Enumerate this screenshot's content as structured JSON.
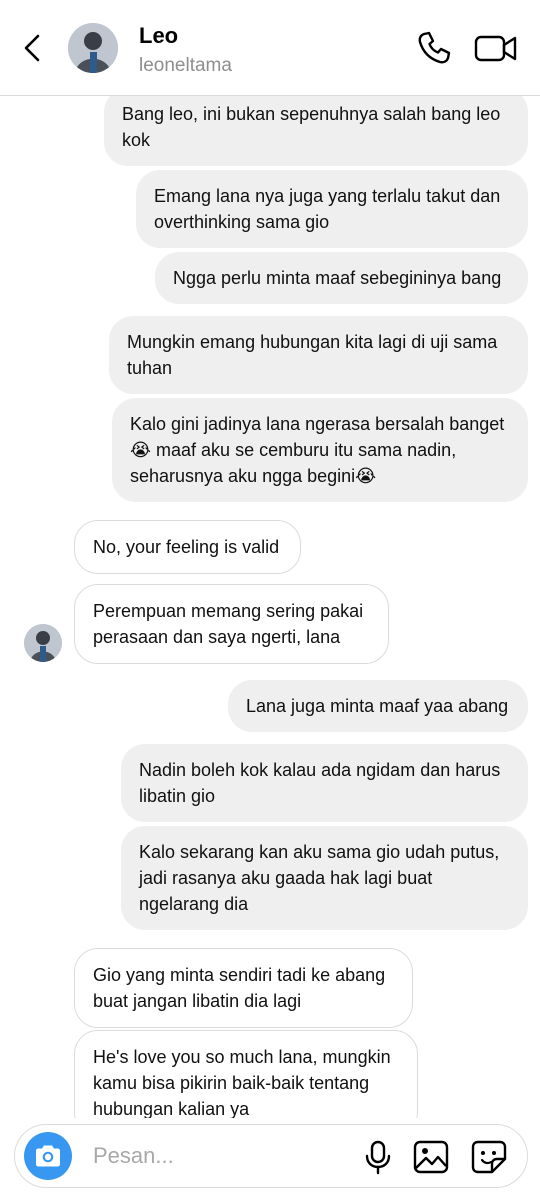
{
  "header": {
    "name": "Leo",
    "username": "leoneltama"
  },
  "messages": [
    {
      "from": "me",
      "text": "Bang leo, ini bukan sepenuhnya salah bang leo\nkok"
    },
    {
      "from": "me",
      "text": "Emang lana nya juga yang terlalu takut dan\noverthinking sama gio"
    },
    {
      "from": "me",
      "text": "Ngga perlu minta maaf sebegininya bang"
    },
    {
      "from": "me",
      "text": "Mungkin emang hubungan kita lagi di uji sama\ntuhan"
    },
    {
      "from": "me",
      "text": "Kalo gini jadinya lana ngerasa bersalah banget\n😭 maaf aku se cemburu itu sama nadin,\nseharusnya aku ngga begini😭"
    },
    {
      "from": "them",
      "text": "No, your feeling is valid"
    },
    {
      "from": "them",
      "text": "Perempuan memang sering pakai\nperasaan dan saya ngerti, lana"
    },
    {
      "from": "me",
      "text": "Lana juga minta maaf yaa abang"
    },
    {
      "from": "me",
      "text": "Nadin boleh kok kalau ada ngidam dan harus\nlibatin gio"
    },
    {
      "from": "me",
      "text": "Kalo sekarang kan aku sama gio udah putus,\njadi rasanya aku gaada hak lagi buat\nngelarang dia"
    },
    {
      "from": "them",
      "text": "Gio yang minta sendiri tadi ke abang\nbuat jangan libatin dia lagi"
    },
    {
      "from": "them",
      "text": "He's love you so much lana, mungkin\nkamu bisa pikirin baik-baik tentang\nhubungan kalian ya"
    }
  ],
  "composer": {
    "placeholder": "Pesan..."
  },
  "icons": {
    "back": "chevron-left-icon",
    "call": "phone-icon",
    "video": "video-camera-icon",
    "camera": "camera-icon",
    "mic": "microphone-icon",
    "gallery": "image-icon",
    "sticker": "sticker-icon"
  },
  "colors": {
    "sent_bubble": "#efefef",
    "received_border": "#dbdbdb",
    "camera_button": "#3897f0",
    "muted_text": "#8e8e8e"
  }
}
